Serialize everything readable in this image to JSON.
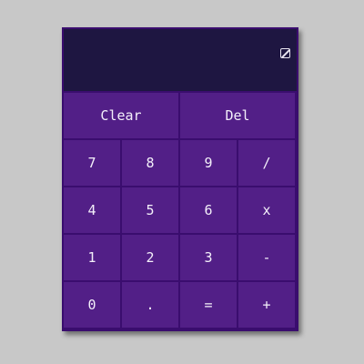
{
  "display": {
    "value": "",
    "icon": "square-slash-icon"
  },
  "keys": {
    "clear": "Clear",
    "del": "Del",
    "row1": [
      "7",
      "8",
      "9",
      "/"
    ],
    "row2": [
      "4",
      "5",
      "6",
      "x"
    ],
    "row3": [
      "1",
      "2",
      "3",
      "-"
    ],
    "row4": [
      "0",
      ".",
      "=",
      "+"
    ]
  },
  "colors": {
    "page_background": "#c8c8c8",
    "frame": "#3a0d6e",
    "display_background": "#1e1641",
    "key_background": "#521f87",
    "key_text": "#f4f0fa"
  }
}
